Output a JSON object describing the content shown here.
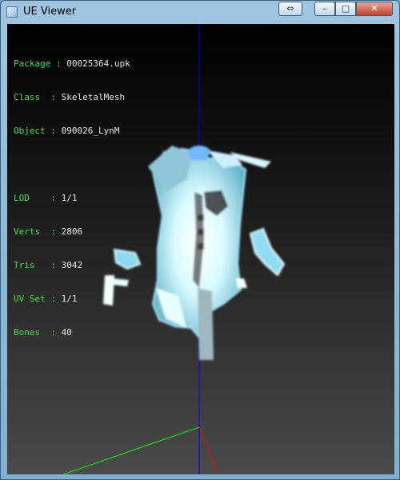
{
  "window": {
    "title": "UE Viewer"
  },
  "titlebar_buttons": {
    "swap": "⇔",
    "minimize": "–",
    "maximize": "□",
    "close": "✕"
  },
  "info": {
    "package_label": "Package",
    "package_value": "00025364.upk",
    "class_label": "Class  ",
    "class_value": "SkeletalMesh",
    "object_label": "Object ",
    "object_value": "090026_LynM",
    "lod_label": "LOD    ",
    "lod_value": "1/1",
    "verts_label": "Verts  ",
    "verts_value": "2806",
    "tris_label": "Tris   ",
    "tris_value": "3042",
    "uvset_label": "UV Set ",
    "uvset_value": "1/1",
    "bones_label": "Bones  ",
    "bones_value": "40"
  },
  "colors": {
    "axis_y": "#0000ff",
    "axis_x": "#ff0000",
    "axis_z": "#00ff00",
    "mesh": "#bff4ff"
  }
}
